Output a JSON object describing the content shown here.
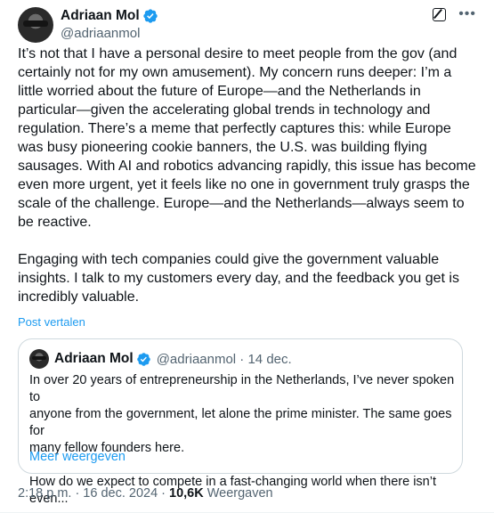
{
  "author": {
    "name": "Adriaan Mol",
    "handle": "@adriaanmol"
  },
  "tweet": {
    "text": "It’s not that I have a personal desire to meet people from the gov (and\ncertainly not for my own amusement). My concern runs deeper: I’m a\nlittle worried about the future of Europe—and the Netherlands in\nparticular—given the accelerating global trends in technology and\nregulation. There’s a meme that perfectly captures this: while Europe\nwas busy pioneering cookie banners, the U.S. was building flying\nsausages. With AI and robotics advancing rapidly, this issue has become\neven more urgent, yet it feels like no one in government truly grasps the\nscale of the challenge. Europe—and the Netherlands—always seem to\nbe reactive.\n\nEngaging with tech companies could give the government valuable\ninsights. I talk to my customers every day, and the feedback you get is\nincredibly valuable.",
    "translate_label": "Post vertalen"
  },
  "quote": {
    "name": "Adriaan Mol",
    "meta": "@adriaanmol · 14 dec.",
    "text": "In over 20 years of entrepreneurship in the Netherlands, I’ve never spoken to\nanyone from the government, let alone the prime minister. The same goes for\nmany fellow founders here.\n\nHow do we expect to compete in a fast-changing world when there isn’t even...",
    "show_more": "Meer weergeven"
  },
  "footer": {
    "time": "2:18 p.m.",
    "date": "16 dec. 2024",
    "separator": "·",
    "views_count": "10,6K",
    "views_label": "Weergaven"
  },
  "icons": {
    "verified": "verified-badge-icon",
    "grok": "grok-icon",
    "more": "more-icon"
  },
  "colors": {
    "accent": "#1d9bf0",
    "secondary_text": "#536471",
    "border": "#cfd9de"
  }
}
